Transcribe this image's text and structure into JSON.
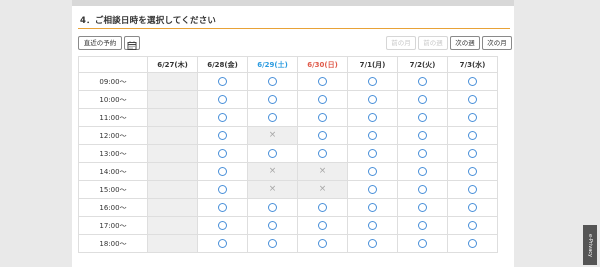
{
  "section": {
    "title": "4．ご相談日時を選択してください"
  },
  "toolbar": {
    "latest_label": "直近の予約",
    "prev_month_label": "前の月",
    "prev_week_label": "前の週",
    "next_week_label": "次の週",
    "next_month_label": "次の月"
  },
  "days": [
    {
      "label": "6/27(木)",
      "type": "weekday"
    },
    {
      "label": "6/28(金)",
      "type": "weekday"
    },
    {
      "label": "6/29(土)",
      "type": "saturday"
    },
    {
      "label": "6/30(日)",
      "type": "sunday"
    },
    {
      "label": "7/1(月)",
      "type": "weekday"
    },
    {
      "label": "7/2(火)",
      "type": "weekday"
    },
    {
      "label": "7/3(水)",
      "type": "weekday"
    }
  ],
  "slots": [
    {
      "time": "09:00〜",
      "status": [
        "na",
        "o",
        "o",
        "o",
        "o",
        "o",
        "o"
      ]
    },
    {
      "time": "10:00〜",
      "status": [
        "na",
        "o",
        "o",
        "o",
        "o",
        "o",
        "o"
      ]
    },
    {
      "time": "11:00〜",
      "status": [
        "na",
        "o",
        "o",
        "o",
        "o",
        "o",
        "o"
      ]
    },
    {
      "time": "12:00〜",
      "status": [
        "na",
        "o",
        "x",
        "o",
        "o",
        "o",
        "o"
      ]
    },
    {
      "time": "13:00〜",
      "status": [
        "na",
        "o",
        "o",
        "o",
        "o",
        "o",
        "o"
      ]
    },
    {
      "time": "14:00〜",
      "status": [
        "na",
        "o",
        "x",
        "x",
        "o",
        "o",
        "o"
      ]
    },
    {
      "time": "15:00〜",
      "status": [
        "na",
        "o",
        "x",
        "x",
        "o",
        "o",
        "o"
      ]
    },
    {
      "time": "16:00〜",
      "status": [
        "na",
        "o",
        "o",
        "o",
        "o",
        "o",
        "o"
      ]
    },
    {
      "time": "17:00〜",
      "status": [
        "na",
        "o",
        "o",
        "o",
        "o",
        "o",
        "o"
      ]
    },
    {
      "time": "18:00〜",
      "status": [
        "na",
        "o",
        "o",
        "o",
        "o",
        "o",
        "o"
      ]
    }
  ],
  "symbols": {
    "full": "×"
  },
  "side_tab": {
    "label": "e-Privacy"
  },
  "colors": {
    "accent": "#e8a237",
    "available": "#4a90d9",
    "saturday": "#2b9be0",
    "sunday": "#e05b4b"
  }
}
